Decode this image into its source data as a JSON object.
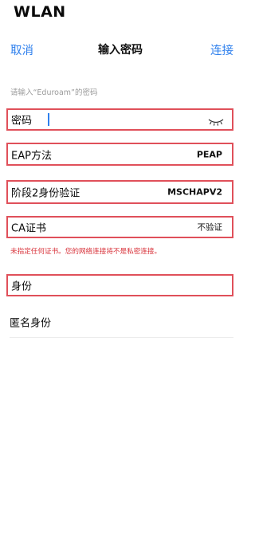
{
  "header": {
    "title": "WLAN"
  },
  "nav": {
    "cancel_label": "取消",
    "title": "输入密码",
    "connect_label": "连接"
  },
  "prompt": "请输入“Eduroam”的密码",
  "fields": {
    "password": {
      "label": "密码",
      "value": "",
      "icon": "eye-closed-icon"
    },
    "eap_method": {
      "label": "EAP方法",
      "value": "PEAP"
    },
    "phase2_auth": {
      "label": "阶段2身份验证",
      "value": "MSCHAPV2"
    },
    "ca_cert": {
      "label": "CA证书",
      "value": "不验证"
    },
    "ca_warning": "未指定任何证书。您的网络连接将不是私密连接。",
    "identity": {
      "label": "身份",
      "value": ""
    },
    "anonymous_identity": {
      "label": "匿名身份",
      "value": ""
    }
  },
  "colors": {
    "accent": "#2f80ed",
    "highlight_border": "#e0505a",
    "warning": "#d8323a",
    "hint": "#9a9a9a"
  }
}
